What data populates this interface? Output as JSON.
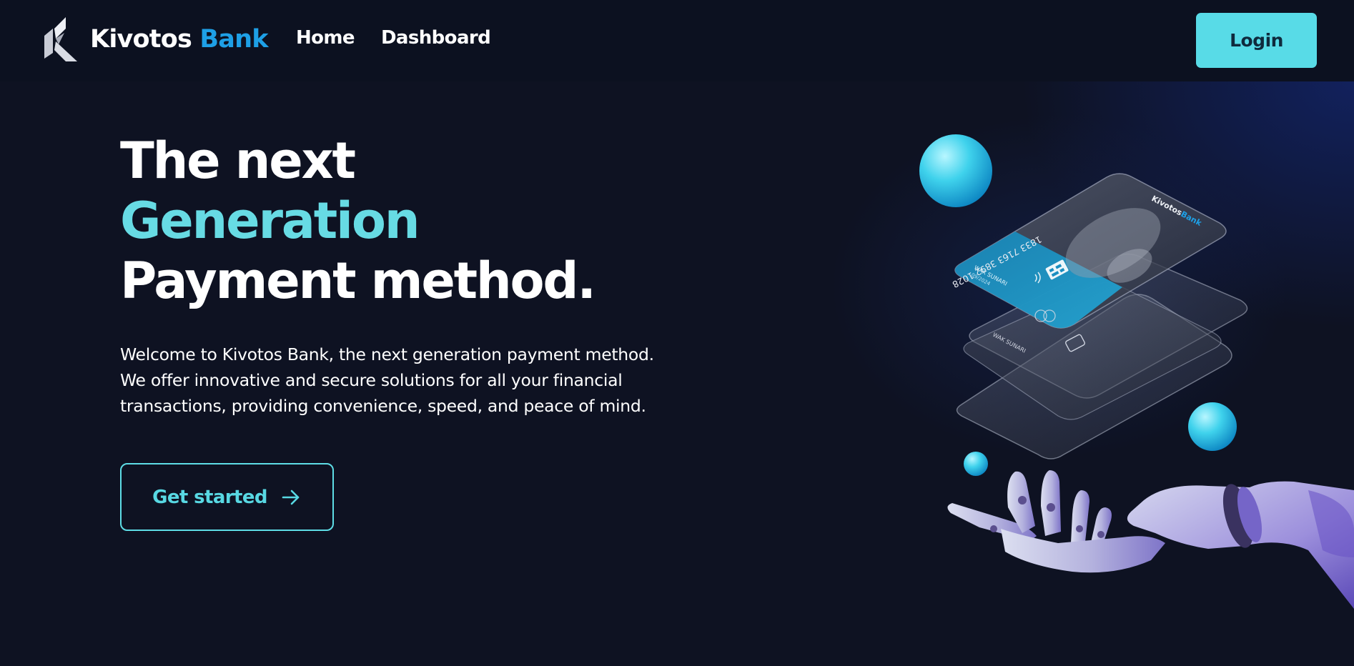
{
  "brand": {
    "name_primary": "Kivotos",
    "name_accent": "Bank",
    "logo_icon": "kivotos-k-logo"
  },
  "nav": {
    "links": [
      {
        "label": "Home"
      },
      {
        "label": "Dashboard"
      }
    ],
    "login_label": "Login"
  },
  "hero": {
    "headline": {
      "line1": "The next",
      "line2": "Generation",
      "line3": "Payment method."
    },
    "description": {
      "line1": "Welcome to Kivotos Bank, the next generation payment method.",
      "line2": "We offer innovative and secure solutions for all your financial",
      "line3": "transactions, providing convenience, speed, and peace of mind."
    },
    "cta_label": "Get started",
    "cta_icon": "arrow-right-icon"
  },
  "illustration": {
    "card_number": "1833 7163 3892 1028",
    "card_brand_primary": "Kivotos",
    "card_brand_accent": "Bank",
    "cardholder_name": "WAK SUNARI",
    "card_expiry": "09/2024"
  },
  "colors": {
    "background": "#0e1222",
    "navbar": "#0c1120",
    "accent_cyan": "#58dbe7",
    "headline_accent": "#67dbe4",
    "brand_blue": "#1ea0e6"
  }
}
